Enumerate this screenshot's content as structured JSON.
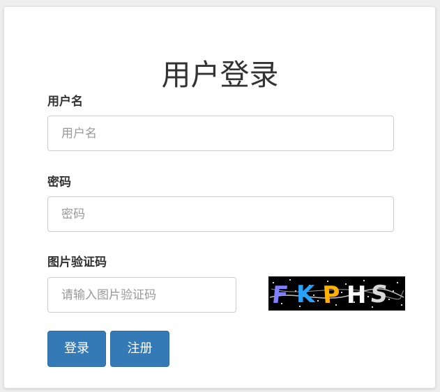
{
  "form": {
    "title": "用户登录",
    "username": {
      "label": "用户名",
      "value": "",
      "placeholder": "用户名"
    },
    "password": {
      "label": "密码",
      "value": "",
      "placeholder": "密码"
    },
    "captcha": {
      "label": "图片验证码",
      "value": "",
      "placeholder": "请输入图片验证码",
      "image_text": "FKPHS"
    },
    "buttons": {
      "login_label": "登录",
      "register_label": "注册"
    }
  },
  "colors": {
    "primary": "#337ab7",
    "captcha_bg": "#000000"
  }
}
